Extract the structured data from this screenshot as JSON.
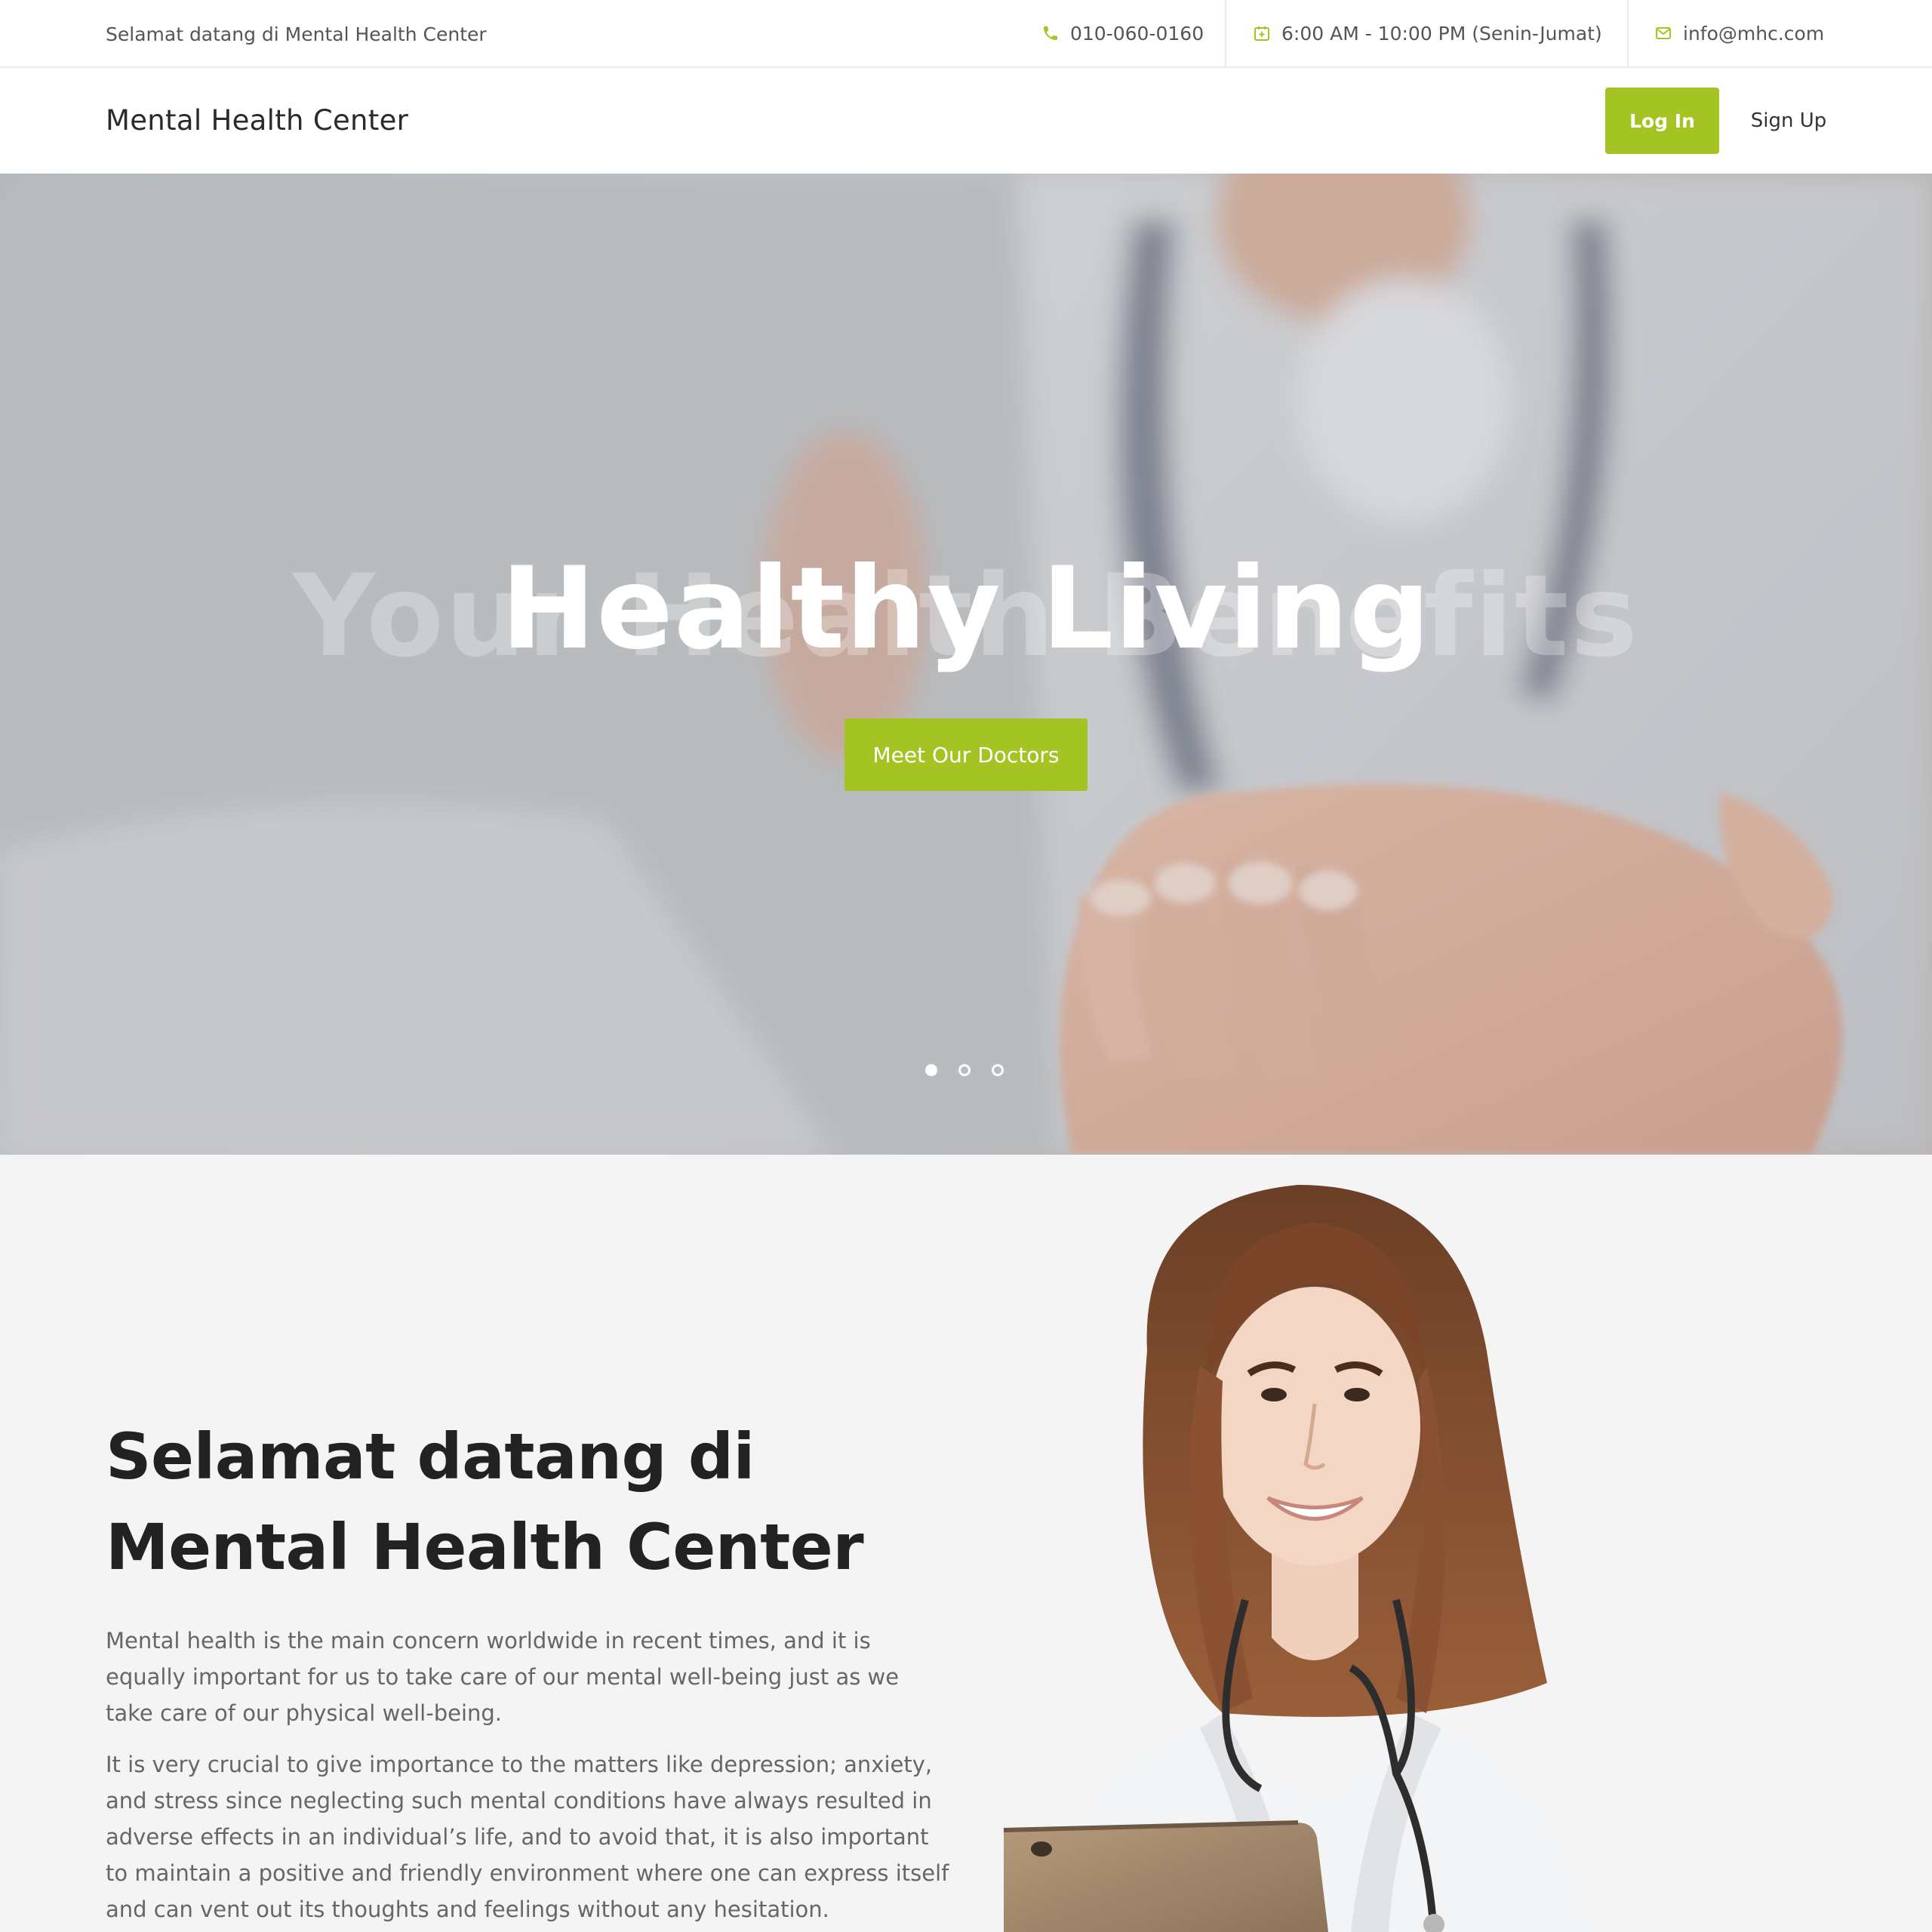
{
  "topbar": {
    "welcome": "Selamat datang di Mental Health Center",
    "phone": "010-060-0160",
    "hours": "6:00 AM - 10:00 PM (Senin-Jumat)",
    "email": "info@mhc.com",
    "icons": {
      "phone": "phone-icon",
      "hours": "calendar-icon",
      "email": "envelope-icon"
    }
  },
  "navbar": {
    "brand": "Mental Health Center",
    "login_label": "Log In",
    "signup_label": "Sign Up"
  },
  "hero": {
    "ghost_text": "Your Health Benefits",
    "title": "Healthy Living",
    "cta_label": "Meet Our Doctors",
    "slides_total": 3,
    "active_slide": 1
  },
  "welcome_section": {
    "title": "Selamat datang di Mental Health Center",
    "paragraph1": "Mental health is the main concern worldwide in recent times, and it is equally important for us to take care of our mental well-being just as we take care of our physical well-being.",
    "paragraph2": "It is very crucial to give importance to the matters like depression; anxiety, and stress since neglecting such mental conditions have always resulted in adverse effects in an individual’s life, and to avoid that, it is also important to maintain a positive and friendly environment where one can express itself and can vent out its thoughts and feelings without any hesitation."
  },
  "colors": {
    "accent": "#a4c424",
    "text_dark": "#222222",
    "text_muted": "#666666",
    "section_bg": "#f4f4f4"
  }
}
